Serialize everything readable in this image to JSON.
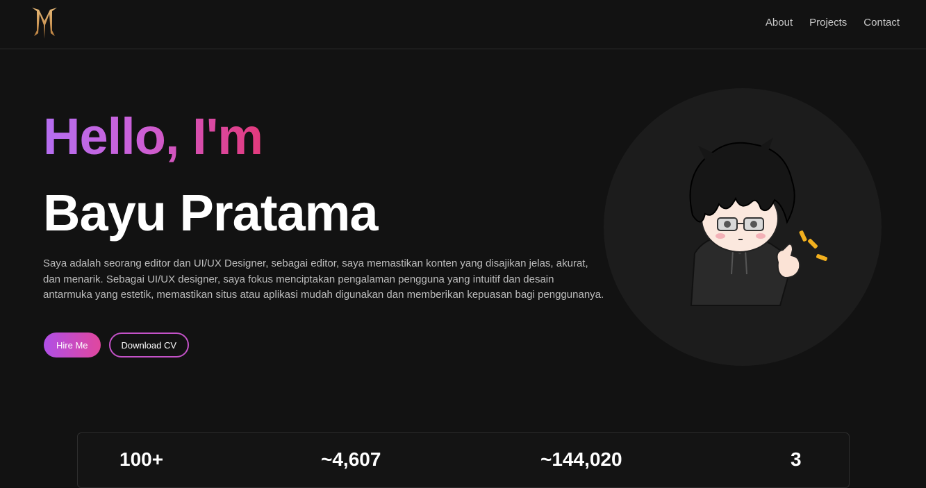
{
  "nav": {
    "logo_icon": "monogram-logo-icon",
    "links": [
      "About",
      "Projects",
      "Contact"
    ]
  },
  "hero": {
    "greeting": "Hello, I'm",
    "name": "Bayu Pratama",
    "bio": "Saya adalah seorang editor dan UI/UX Designer, sebagai editor, saya memastikan konten yang disajikan jelas, akurat, dan menarik. Sebagai UI/UX designer, saya fokus menciptakan pengalaman pengguna yang intuitif dan desain antarmuka yang estetik, memastikan situs atau aplikasi mudah digunakan dan memberikan kepuasan bagi penggunanya.",
    "hire_label": "Hire Me",
    "download_label": "Download CV",
    "avatar_icon": "chibi-avatar-thumbs-up"
  },
  "stats": [
    "100+",
    "~4,607",
    "~144,020",
    "3"
  ],
  "colors": {
    "background": "#121212",
    "gradient_start": "#b56ef0",
    "gradient_end": "#e3397b",
    "logo": "#d9a25f"
  }
}
